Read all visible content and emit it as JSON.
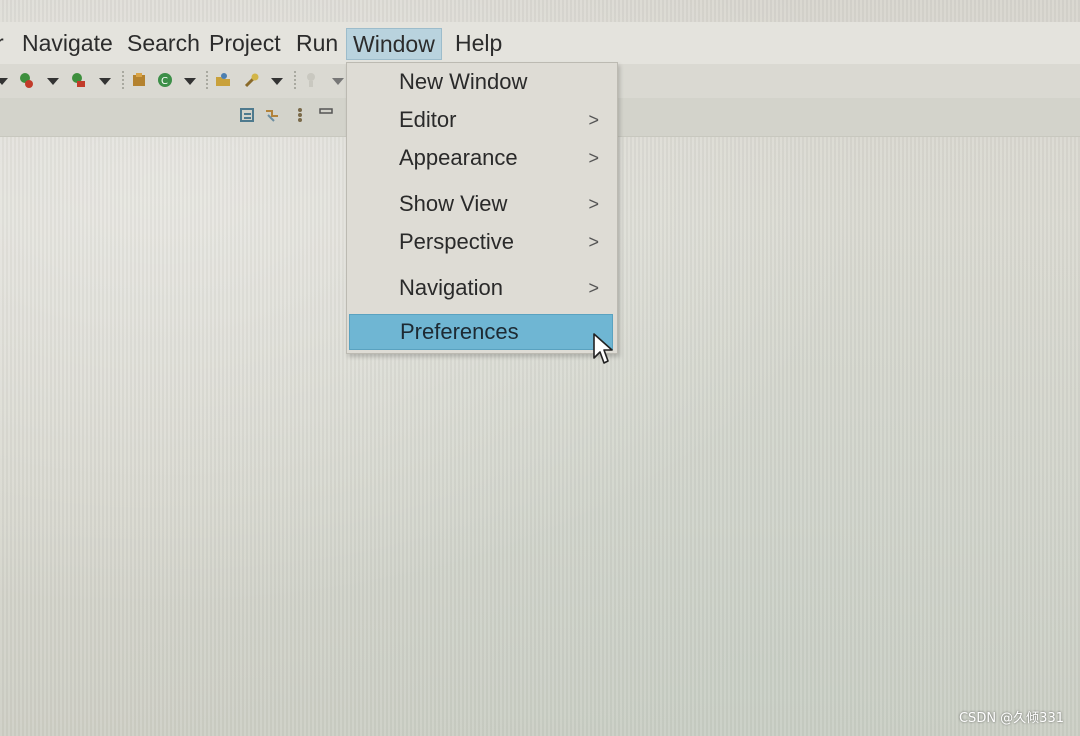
{
  "menubar": {
    "items": [
      "r",
      "Navigate",
      "Search",
      "Project",
      "Run",
      "Window",
      "Help"
    ],
    "active": "Window"
  },
  "window_menu": {
    "items": [
      {
        "label": "New Window",
        "has_submenu": false
      },
      {
        "label": "Editor",
        "has_submenu": true
      },
      {
        "label": "Appearance",
        "has_submenu": true
      },
      {
        "label": "Show View",
        "has_submenu": true
      },
      {
        "label": "Perspective",
        "has_submenu": true
      },
      {
        "label": "Navigation",
        "has_submenu": true
      },
      {
        "label": "Preferences",
        "has_submenu": false,
        "highlighted": true
      }
    ],
    "submenu_glyph": ">"
  },
  "toolbar": {
    "icons": [
      "debug-icon",
      "run-icon",
      "external-tools-icon",
      "new-package-icon",
      "new-class-icon",
      "open-type-icon",
      "search-icon",
      "annotation-icon"
    ],
    "secondary_icons": [
      "toggle-mark-occurrences-icon",
      "link-editor-icon",
      "outline-icon",
      "minimize-icon"
    ]
  },
  "colors": {
    "highlight": "#6fb6d3",
    "active_menu": "#b9d3de"
  },
  "watermark": "CSDN @久倾331"
}
